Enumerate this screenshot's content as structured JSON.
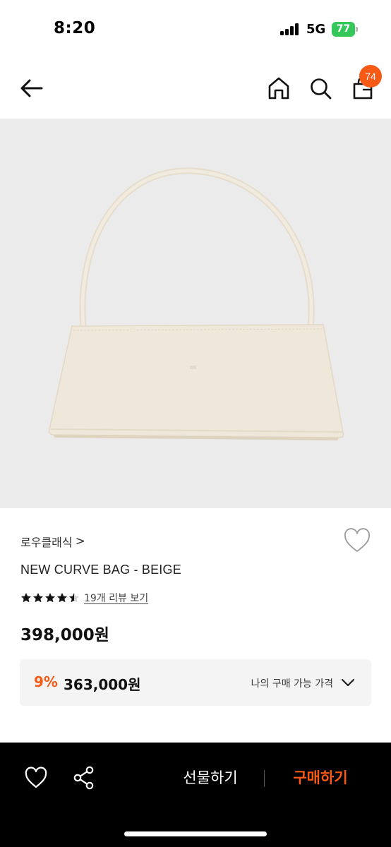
{
  "status_bar": {
    "time": "8:20",
    "network": "5G",
    "battery": "77"
  },
  "header": {
    "back_icon": "arrow-left-icon",
    "home_icon": "home-icon",
    "search_icon": "search-icon",
    "cart_icon": "shopping-bag-icon",
    "cart_count": "74"
  },
  "product": {
    "image_alt": "beige curved shoulder bag",
    "brand": "로우클래식",
    "brand_chevron": ">",
    "name": "NEW CURVE BAG - BEIGE",
    "rating": 4.5,
    "rating_max": 5,
    "review_link": "19개 리뷰 보기",
    "price": "398,000원"
  },
  "deal": {
    "discount": "9%",
    "price": "363,000원",
    "label": "나의 구매 가능 가격"
  },
  "bottom_bar": {
    "wishlist_icon": "heart-icon",
    "share_icon": "share-icon",
    "gift_label": "선물하기",
    "buy_label": "구매하기"
  },
  "colors": {
    "accent": "#f65a14",
    "image_background": "#ebebeb",
    "bag": "#efe8da",
    "battery": "#34c759"
  }
}
